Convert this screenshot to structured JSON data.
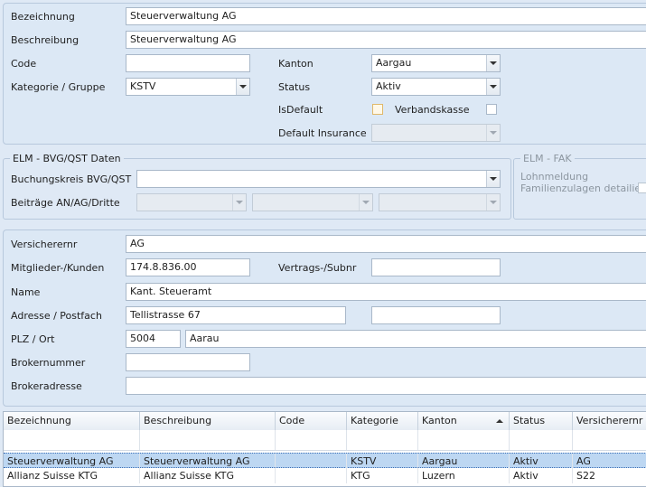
{
  "top": {
    "bezeichnung_label": "Bezeichnung",
    "bezeichnung_value": "Steuerverwaltung AG",
    "beschreibung_label": "Beschreibung",
    "beschreibung_value": "Steuerverwaltung AG",
    "code_label": "Code",
    "code_value": "",
    "kanton_label": "Kanton",
    "kanton_value": "Aargau",
    "kategorie_label": "Kategorie / Gruppe",
    "kategorie_value": "KSTV",
    "status_label": "Status",
    "status_value": "Aktiv",
    "isdefault_label": "IsDefault",
    "verbandskasse_label": "Verbandskasse",
    "default_insurance_label": "Default Insurance",
    "default_insurance_value": ""
  },
  "elm_bvg": {
    "title": "ELM - BVG/QST Daten",
    "buchungskreis_label": "Buchungskreis BVG/QST",
    "buchungskreis_value": "",
    "beitraege_label": "Beiträge AN/AG/Dritte"
  },
  "elm_fak": {
    "title": "ELM - FAK",
    "lohnmeldung_label": "Lohnmeldung",
    "familienzulagen_label": "Familienzulagen detailiert"
  },
  "versicherer": {
    "versicherernr_label": "Versicherernr",
    "versicherernr_value": "AG",
    "mitglieder_label": "Mitglieder-/Kunden",
    "mitglieder_value": "174.8.836.00",
    "vertrags_label": "Vertrags-/Subnr",
    "vertrags_value": "",
    "name_label": "Name",
    "name_value": "Kant. Steueramt",
    "adresse_label": "Adresse / Postfach",
    "adresse_value": "Tellistrasse 67",
    "postfach_value": "",
    "plz_label": "PLZ / Ort",
    "plz_value": "5004",
    "ort_value": "Aarau",
    "brokernummer_label": "Brokernummer",
    "brokernummer_value": "",
    "brokeradresse_label": "Brokeradresse",
    "brokeradresse_value": ""
  },
  "grid": {
    "columns": [
      "Bezeichnung",
      "Beschreibung",
      "Code",
      "Kategorie",
      "Kanton",
      "Status",
      "Versicherernr"
    ],
    "sorted_column": "Kanton",
    "rows": [
      [
        "Steuerverwaltung AG",
        "Steuerverwaltung AG",
        "",
        "KSTV",
        "Aargau",
        "Aktiv",
        "AG"
      ],
      [
        "Allianz Suisse KTG",
        "Allianz Suisse KTG",
        "",
        "KTG",
        "Luzern",
        "Aktiv",
        "S22"
      ]
    ]
  },
  "colors": {
    "panel": "#dce8f5",
    "border": "#a9b8c9",
    "selection": "#bdd7f2"
  }
}
